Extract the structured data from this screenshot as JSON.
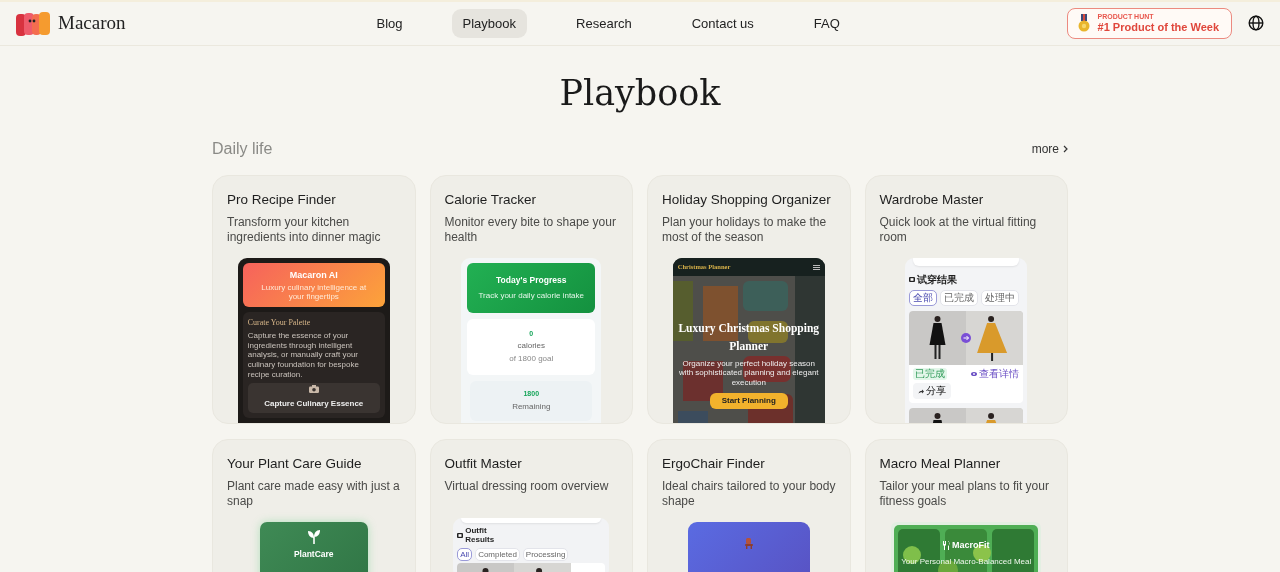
{
  "header": {
    "brand": "Macaron",
    "nav": [
      {
        "label": "Blog",
        "selected": false
      },
      {
        "label": "Playbook",
        "selected": true
      },
      {
        "label": "Research",
        "selected": false
      },
      {
        "label": "Contact us",
        "selected": false
      },
      {
        "label": "FAQ",
        "selected": false
      }
    ],
    "badge": {
      "eyebrow": "PRODUCT HUNT",
      "title": "#1 Product of the Week"
    }
  },
  "page_title": "Playbook",
  "section": {
    "title": "Daily life",
    "more": "more"
  },
  "cards": [
    {
      "title": "Pro Recipe Finder",
      "description": "Transform your kitchen ingredients into dinner magic",
      "preview": {
        "kind": "recipe",
        "app_name": "Macaron AI",
        "tagline": "Luxury culinary intelligence at your fingertips",
        "heading": "Curate Your Palette",
        "body": "Capture the essence of your ingredients through intelligent analysis, or manually craft your culinary foundation for bespoke recipe curation.",
        "action": "Capture Culinary Essence"
      }
    },
    {
      "title": "Calorie Tracker",
      "description": "Monitor every bite to shape your health",
      "preview": {
        "kind": "calorie",
        "heading": "Today's Progress",
        "subheading": "Track your daily calorie intake",
        "stats": [
          {
            "value": "0",
            "label": "calories",
            "note": "of 1800 goal"
          },
          {
            "value": "1800",
            "label": "Remaining"
          }
        ]
      }
    },
    {
      "title": "Holiday Shopping Organizer",
      "description": "Plan your holidays to make the most of the season",
      "preview": {
        "kind": "planner",
        "app_name": "Christmas Planner",
        "heading": "Luxury Christmas Shopping Planner",
        "body": "Organize your perfect holiday season with sophisticated planning and elegant execution",
        "action": "Start Planning"
      }
    },
    {
      "title": "Wardrobe Master",
      "description": "Quick look at the virtual fitting room",
      "preview": {
        "kind": "fitting",
        "heading": "试穿结果",
        "tabs": [
          {
            "label": "全部",
            "selected": true
          },
          {
            "label": "已完成",
            "selected": false
          },
          {
            "label": "处理中",
            "selected": false
          }
        ],
        "status": "已完成",
        "link": "查看详情",
        "action": "分享"
      }
    },
    {
      "title": "Your Plant Care Guide",
      "description": "Plant care made easy with just a snap",
      "preview": {
        "kind": "plant",
        "app_name": "PlantCare"
      }
    },
    {
      "title": "Outfit Master",
      "description": "Virtual dressing room overview",
      "preview": {
        "kind": "outfit",
        "heading": "Outfit Results",
        "tabs": [
          {
            "label": "All",
            "selected": true
          },
          {
            "label": "Completed",
            "selected": false
          },
          {
            "label": "Processing",
            "selected": false
          }
        ]
      }
    },
    {
      "title": "ErgoChair Finder",
      "description": "Ideal chairs tailored to your body shape",
      "preview": {
        "kind": "chair"
      }
    },
    {
      "title": "Macro Meal Planner",
      "description": "Tailor your meal plans to fit your fitness goals",
      "preview": {
        "kind": "meal",
        "app_name": "MacroFit",
        "tagline": "Your Personal Macro-Balanced Meal"
      }
    }
  ]
}
